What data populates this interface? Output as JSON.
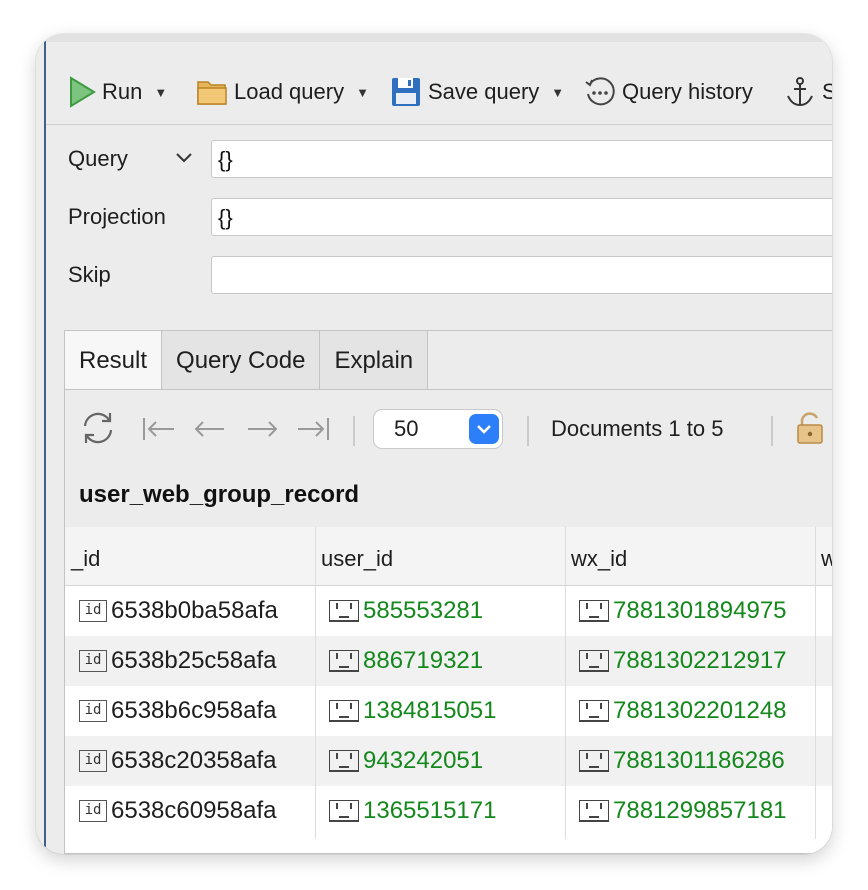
{
  "toolbar": {
    "run_label": "Run",
    "load_query_label": "Load query",
    "save_query_label": "Save query",
    "query_history_label": "Query history",
    "next_label": "S"
  },
  "query_form": {
    "query_label": "Query",
    "query_value": "{}",
    "projection_label": "Projection",
    "projection_value": "{}",
    "skip_label": "Skip",
    "skip_value": ""
  },
  "tabs": [
    {
      "label": "Result",
      "active": true
    },
    {
      "label": "Query Code",
      "active": false
    },
    {
      "label": "Explain",
      "active": false
    }
  ],
  "pager": {
    "page_size": "50",
    "documents_text": "Documents 1 to 5"
  },
  "collection_name": "user_web_group_record",
  "table": {
    "columns": [
      "_id",
      "user_id",
      "wx_id",
      "w"
    ],
    "rows": [
      {
        "id": "6538b0ba58afa",
        "user_id": "585553281",
        "wx_id": "7881301894975"
      },
      {
        "id": "6538b25c58afa",
        "user_id": "886719321",
        "wx_id": "7881302212917"
      },
      {
        "id": "6538b6c958afa",
        "user_id": "1384815051",
        "wx_id": "7881302201248"
      },
      {
        "id": "6538c20358afa",
        "user_id": "943242051",
        "wx_id": "7881301186286"
      },
      {
        "id": "6538c60958afa",
        "user_id": "1365515171",
        "wx_id": "7881299857181"
      }
    ]
  },
  "colors": {
    "value_green": "#14881c",
    "accent_blue": "#2d7ff9",
    "run_green": "#4caf50"
  },
  "icons": {
    "run": "play-triangle-icon",
    "load": "folder-icon",
    "save": "floppy-disk-icon",
    "history": "clock-dots-icon",
    "anchor": "anchor-icon",
    "refresh": "refresh-icon",
    "first": "first-page-icon",
    "prev": "previous-page-icon",
    "next": "next-page-icon",
    "last": "last-page-icon",
    "lock": "lock-icon",
    "id_type": "id-type-icon",
    "string_type": "string-type-icon"
  }
}
